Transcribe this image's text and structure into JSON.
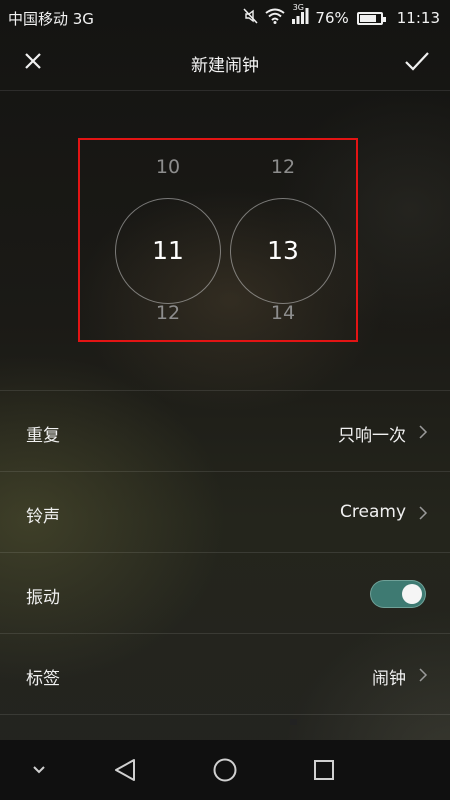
{
  "status_bar": {
    "carrier": "中国移动 3G",
    "network_type": "3G",
    "battery_percent": "76%",
    "battery_level": 0.76,
    "time": "11:13",
    "icons": [
      "mute-icon",
      "wifi-icon",
      "signal-icon",
      "battery-icon"
    ]
  },
  "header": {
    "title": "新建闹钟",
    "close_icon": "close-icon",
    "confirm_icon": "check-icon"
  },
  "time_picker": {
    "hour": {
      "prev": "10",
      "current": "11",
      "next": "12"
    },
    "minute": {
      "prev": "12",
      "current": "13",
      "next": "14"
    },
    "highlight_color": "#e31414"
  },
  "settings": {
    "repeat": {
      "label": "重复",
      "value": "只响一次"
    },
    "ringtone": {
      "label": "铃声",
      "value": "Creamy"
    },
    "vibrate": {
      "label": "振动",
      "enabled": true,
      "toggle_color": "#3e7a72"
    },
    "tag": {
      "label": "标签",
      "value": "闹钟"
    }
  },
  "nav_bar": {
    "buttons": [
      "chevron-down-icon",
      "back-icon",
      "home-icon",
      "recents-icon"
    ]
  }
}
